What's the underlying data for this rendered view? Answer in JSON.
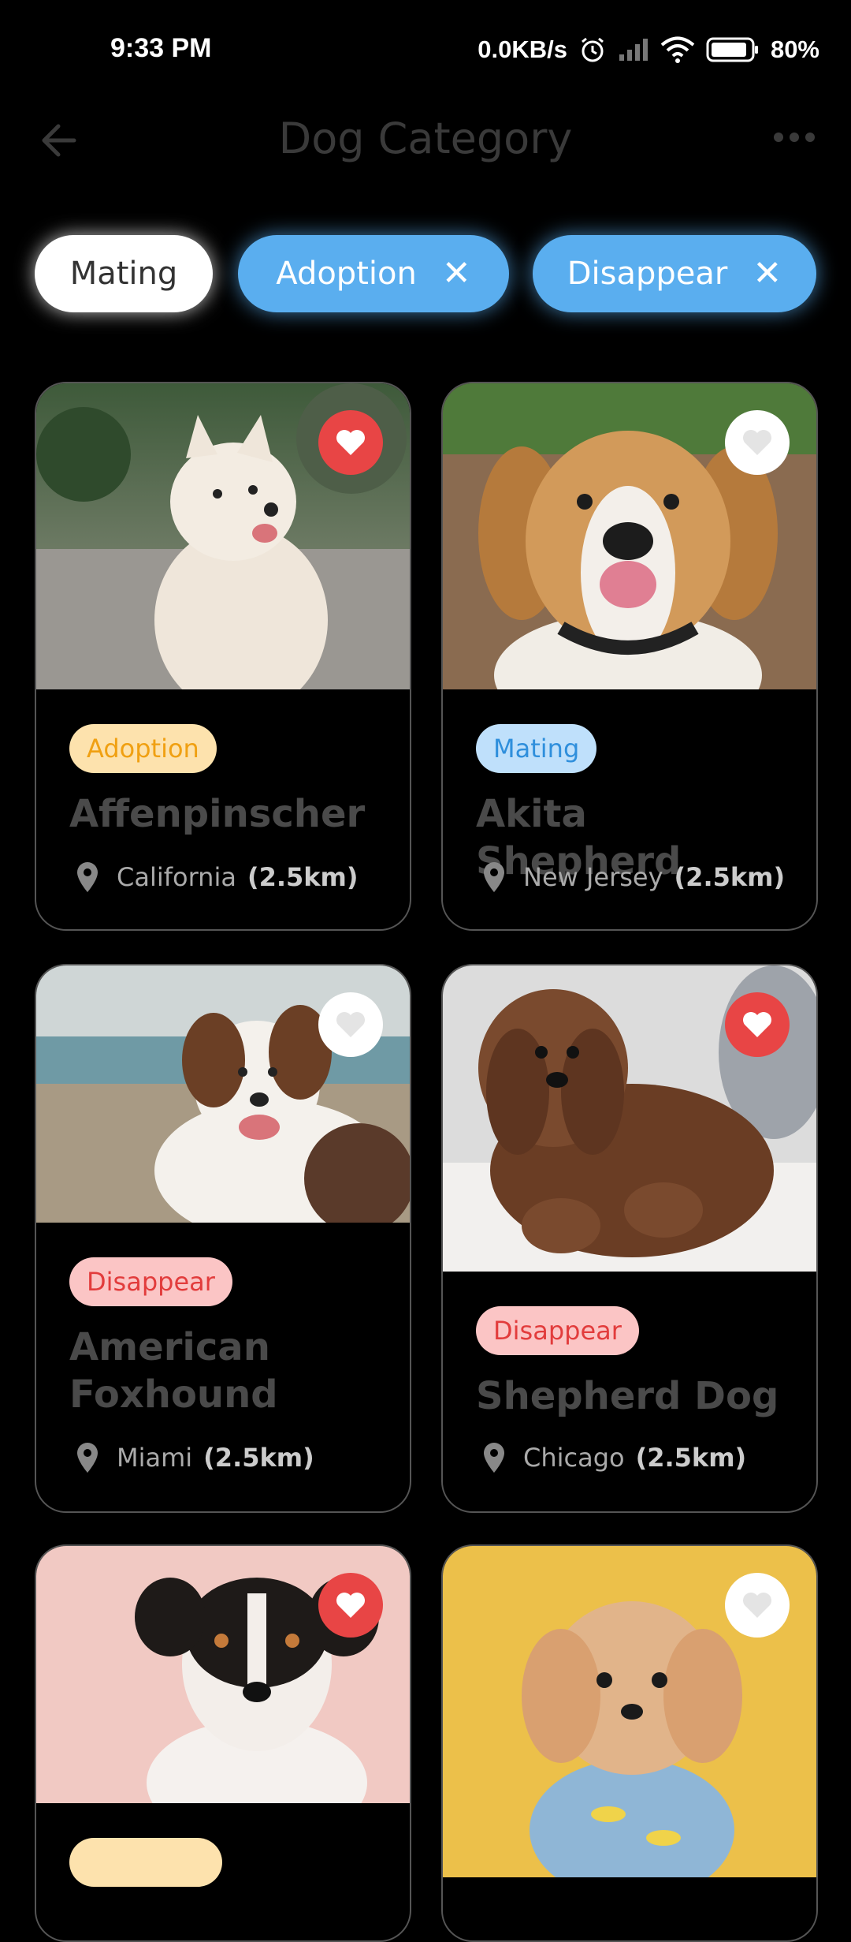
{
  "status_bar": {
    "time": "9:33 PM",
    "net_speed": "0.0KB/s",
    "battery": "80%",
    "icons": [
      "alarm-icon",
      "signal-icon",
      "wifi-icon",
      "battery-icon"
    ]
  },
  "header": {
    "title": "Dog Category",
    "back_icon": "arrow-left-icon",
    "more_icon": "more-dots-icon"
  },
  "filters": [
    {
      "label": "Mating",
      "selected": false,
      "removable": false
    },
    {
      "label": "Adoption",
      "selected": true,
      "removable": true,
      "remove_icon": "close-icon"
    },
    {
      "label": "Disappear",
      "selected": true,
      "removable": true,
      "remove_icon": "close-icon"
    }
  ],
  "dogs": [
    {
      "tag": "Adoption",
      "name": "Affenpinscher",
      "location": "California",
      "distance": "(2.5km)",
      "favorite": true
    },
    {
      "tag": "Mating",
      "name": "Akita Shepherd",
      "location": "New Jersey",
      "distance": "(2.5km)",
      "favorite": false
    },
    {
      "tag": "Disappear",
      "name": "American Foxhound",
      "location": "Miami",
      "distance": "(2.5km)",
      "favorite": false
    },
    {
      "tag": "Disappear",
      "name": "Shepherd Dog",
      "location": "Chicago",
      "distance": "(2.5km)",
      "favorite": true
    },
    {
      "tag": "",
      "name": "",
      "location": "",
      "distance": "",
      "favorite": true
    },
    {
      "tag": "",
      "name": "",
      "location": "",
      "distance": "",
      "favorite": false
    }
  ],
  "colors": {
    "background": "#000000",
    "chip_active": "#5aaeef",
    "favorite_on": "#e84545",
    "tag_adoption": "#f0a012",
    "tag_mating": "#2f8fdc",
    "tag_disappear": "#e23c3c"
  }
}
